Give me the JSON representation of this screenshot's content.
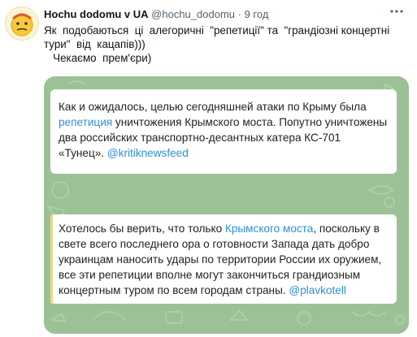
{
  "author": {
    "name": "Hochu dodomu v UA",
    "handle": "@hochu_dodomu",
    "separator": "·",
    "time": "9 год"
  },
  "more_icon": "more-horizontal-icon",
  "tweet_text": "Як  подобаються  ці  алегоричні  \"репетиції\" та  \"грандіозні концертні\nтури\"  від  кацапів)))\n   Чекаємо  прем'єри)",
  "message1": {
    "p1": "Как и ожидалось, целью сегодняшней атаки по Крыму была ",
    "link1": "репетиция",
    "p2": " уничтожения Крымского моста. Попутно уничтожены два российских транспортно-десантных катера КС-701 «Тунец». ",
    "link2": "@kritiknewsfeed"
  },
  "message2": {
    "p1": "Хотелось бы верить, что только ",
    "link1": "Крымского моста",
    "p2": ", поскольку в свете всего последнего ора о готовности Запада дать добро украинцам наносить удары по территории России их оружием, все эти репетиции вполне могут закончиться грандиозным концертным туром по всем городам страны. ",
    "link2": "@plavkotell"
  },
  "colors": {
    "link": "#2f8fd8",
    "chat_background": "#9cc196",
    "quote_bar": "#eed68a"
  }
}
